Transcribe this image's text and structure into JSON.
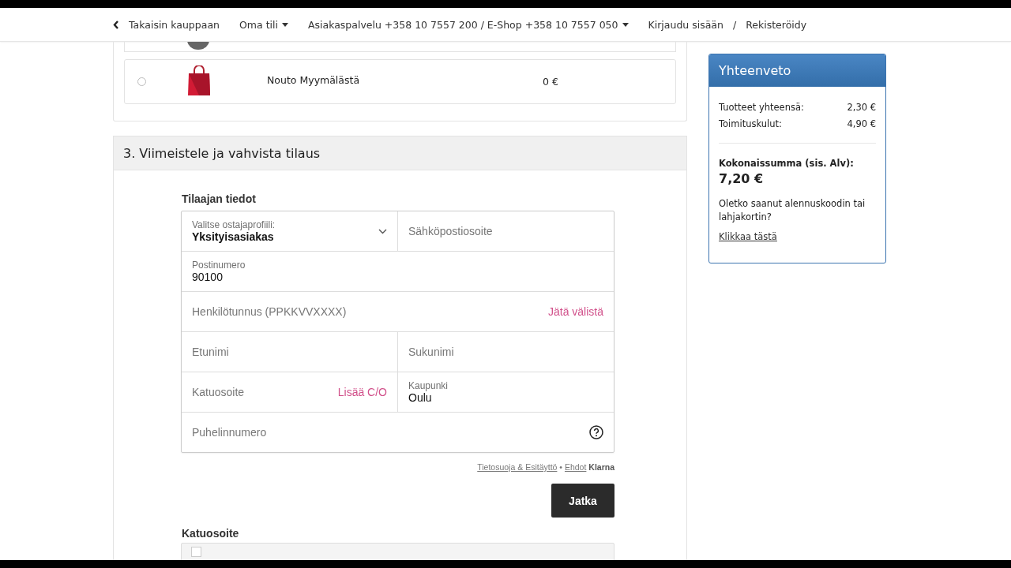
{
  "nav": {
    "back_link": "Takaisin kauppaan",
    "menus": [
      {
        "label": "Oma tili"
      },
      {
        "label": "Asiakaspalvelu +358 10 7557 200 / E-Shop +358 10 7557 050"
      }
    ],
    "login": "Kirjaudu sisään",
    "separator": "/",
    "register": "Rekisteröidy"
  },
  "shipping_options": [
    {
      "name": "Nouto Myymälästä",
      "price": "0 €",
      "selected": false
    }
  ],
  "section": {
    "title": "3. Viimeistele ja vahvista tilaus"
  },
  "form": {
    "title": "Tilaajan tiedot",
    "rows": [
      [
        {
          "kind": "select",
          "label": "Valitse ostajaprofiili:",
          "value": "Yksityisasiakas"
        },
        {
          "kind": "text",
          "placeholder": "Sähköpostiosoite"
        }
      ],
      [
        {
          "kind": "filled",
          "label": "Postinumero",
          "value": "90100"
        }
      ],
      [
        {
          "kind": "text",
          "placeholder": "Henkilötunnus (PPKKVVXXXX)",
          "action": "Jätä välistä"
        }
      ],
      [
        {
          "kind": "text",
          "placeholder": "Etunimi"
        },
        {
          "kind": "text",
          "placeholder": "Sukunimi"
        }
      ],
      [
        {
          "kind": "text",
          "placeholder": "Katuosoite",
          "action": "Lisää C/O"
        },
        {
          "kind": "filled",
          "label": "Kaupunki",
          "value": "Oulu"
        }
      ],
      [
        {
          "kind": "help",
          "placeholder": "Puhelinnumero"
        }
      ]
    ],
    "legal": {
      "privacy_link": "Tietosuoja & Esitäyttö",
      "dot": "•",
      "terms_link": "Ehdot",
      "brand": "Klarna"
    },
    "submit": "Jatka",
    "next_heading": "Katuosoite",
    "next_option": {
      "checked": false
    }
  },
  "summary": {
    "title": "Yhteenveto",
    "lines": [
      {
        "label": "Tuotteet yhteensä:",
        "value": "2,30 €"
      },
      {
        "label": "Toimituskulut:",
        "value": "4,90 €"
      }
    ],
    "total_label": "Kokonaissumma (sis. Alv):",
    "total": "7,20 €",
    "promo_text": "Oletko saanut alennuskoodin tai lahjakortin?",
    "promo_link": "Klikkaa tästä"
  }
}
